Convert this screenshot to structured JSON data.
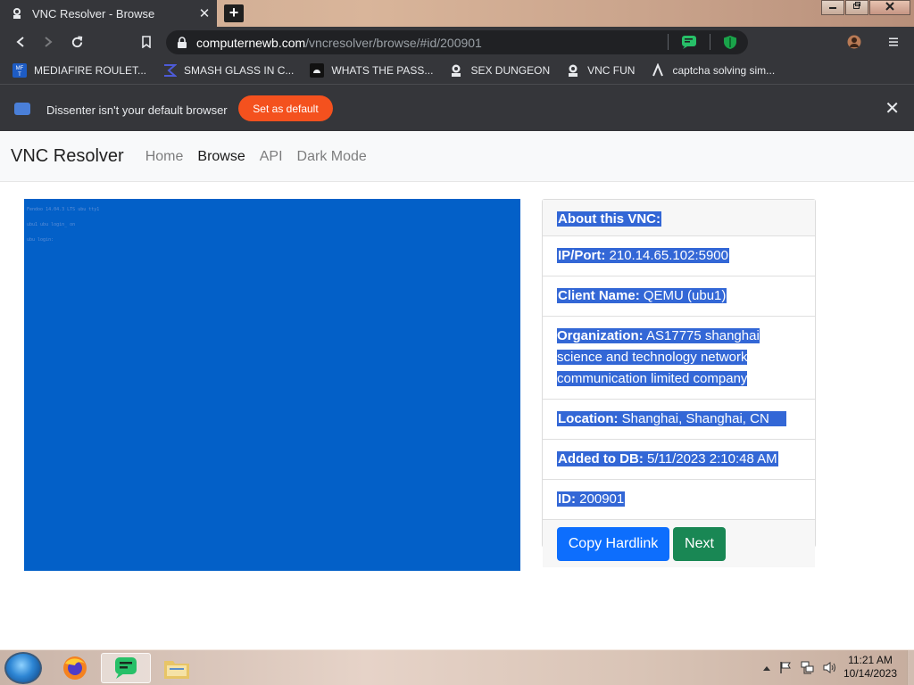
{
  "browser": {
    "tab_title": "VNC Resolver - Browse",
    "tab_close": "✕",
    "new_tab": "+",
    "url_host": "computernewb.com",
    "url_path": "/vncresolver/browse/#id/200901"
  },
  "bookmarks": [
    {
      "label": "MEDIAFIRE ROULET...",
      "icon": "mediafire-icon"
    },
    {
      "label": "SMASH GLASS IN C...",
      "icon": "sigma-icon"
    },
    {
      "label": "WHATS THE PASS...",
      "icon": "android-icon"
    },
    {
      "label": "SEX DUNGEON",
      "icon": "vnc-icon"
    },
    {
      "label": "VNC FUN",
      "icon": "vnc-icon"
    },
    {
      "label": "captcha solving sim...",
      "icon": "lambda-icon"
    }
  ],
  "infobar": {
    "message": "Dissenter isn't your default browser",
    "button": "Set as default",
    "close": "✕"
  },
  "page": {
    "brand": "VNC Resolver",
    "nav": [
      "Home",
      "Browse",
      "API",
      "Dark Mode"
    ],
    "screen_lines": [
      "Fendoo 14.04.3 LTS ubu tty1",
      "ubu1 ubu login_ on",
      "ubu login:"
    ],
    "card": {
      "header": "About this VNC:",
      "ip_label": "IP/Port:",
      "ip_value": "210.14.65.102:5900",
      "client_label": "Client Name:",
      "client_value": "QEMU (ubu1)",
      "org_label": "Organization:",
      "org_value": "AS17775 shanghai science and technology network communication limited company",
      "location_label": "Location:",
      "location_value": "Shanghai, Shanghai, CN",
      "added_label": "Added to DB:",
      "added_value": "5/11/2023 2:10:48 AM",
      "id_label": "ID:",
      "id_value": "200901",
      "copy_button": "Copy Hardlink",
      "next_button": "Next"
    }
  },
  "taskbar": {
    "time": "11:21 AM",
    "date": "10/14/2023"
  },
  "colors": {
    "selection": "#3367d6",
    "vnc_screen": "#0360c8",
    "primary": "#0d6efd",
    "success": "#198754",
    "set_default": "#f4511e"
  }
}
